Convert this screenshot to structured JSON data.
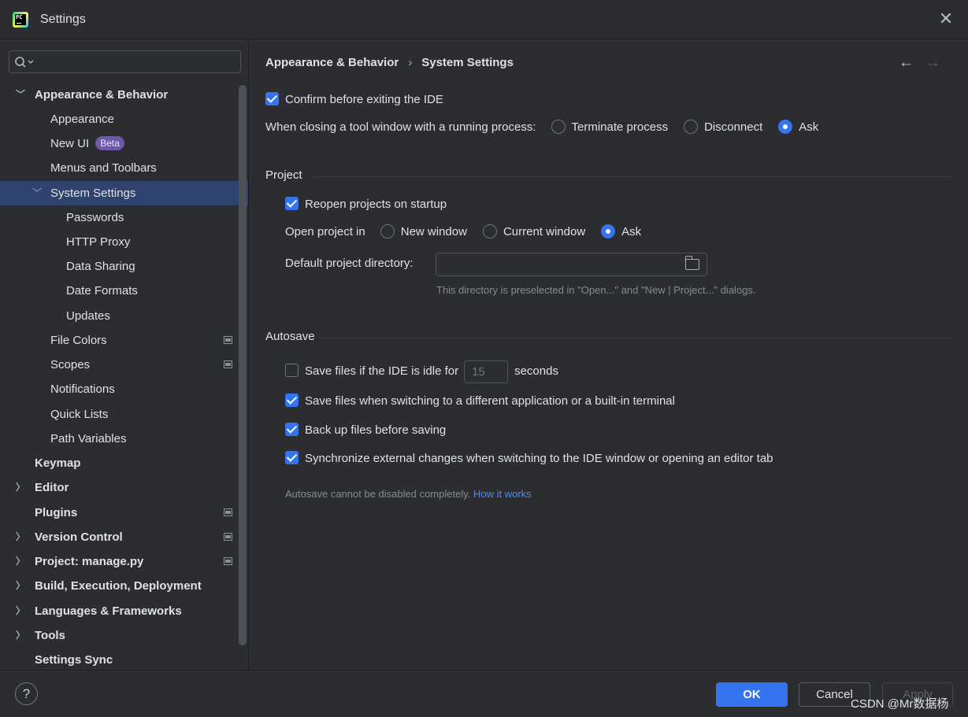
{
  "window": {
    "title": "Settings"
  },
  "sidebar": {
    "search_placeholder": "",
    "items": [
      {
        "label": "Appearance & Behavior",
        "expanded": true
      },
      {
        "label": "Appearance"
      },
      {
        "label": "New UI",
        "badge": "Beta"
      },
      {
        "label": "Menus and Toolbars"
      },
      {
        "label": "System Settings",
        "expanded": true,
        "selected": true
      },
      {
        "label": "Passwords"
      },
      {
        "label": "HTTP Proxy"
      },
      {
        "label": "Data Sharing"
      },
      {
        "label": "Date Formats"
      },
      {
        "label": "Updates"
      },
      {
        "label": "File Colors",
        "project_level": true
      },
      {
        "label": "Scopes",
        "project_level": true
      },
      {
        "label": "Notifications"
      },
      {
        "label": "Quick Lists"
      },
      {
        "label": "Path Variables"
      },
      {
        "label": "Keymap"
      },
      {
        "label": "Editor"
      },
      {
        "label": "Plugins",
        "project_level": true
      },
      {
        "label": "Version Control",
        "project_level": true
      },
      {
        "label": "Project: manage.py",
        "project_level": true
      },
      {
        "label": "Build, Execution, Deployment"
      },
      {
        "label": "Languages & Frameworks"
      },
      {
        "label": "Tools"
      },
      {
        "label": "Settings Sync"
      }
    ]
  },
  "breadcrumb": {
    "parent": "Appearance & Behavior",
    "current": "System Settings"
  },
  "general": {
    "confirm_exit": {
      "label": "Confirm before exiting the IDE",
      "checked": true
    },
    "closing_tool_window": {
      "label": "When closing a tool window with a running process:",
      "options": [
        "Terminate process",
        "Disconnect",
        "Ask"
      ],
      "selected": "Ask"
    }
  },
  "project": {
    "title": "Project",
    "reopen": {
      "label": "Reopen projects on startup",
      "checked": true
    },
    "open_in": {
      "label": "Open project in",
      "options": [
        "New window",
        "Current window",
        "Ask"
      ],
      "selected": "Ask"
    },
    "default_dir": {
      "label": "Default project directory:",
      "value": "",
      "hint": "This directory is preselected in \"Open...\" and \"New | Project...\" dialogs."
    }
  },
  "autosave": {
    "title": "Autosave",
    "idle": {
      "label": "Save files if the IDE is idle for",
      "value": "15",
      "unit": "seconds",
      "checked": false
    },
    "switch_app": {
      "label": "Save files when switching to a different application or a built-in terminal",
      "checked": true
    },
    "backup": {
      "label": "Back up files before saving",
      "checked": true
    },
    "sync": {
      "label": "Synchronize external changes when switching to the IDE window or opening an editor tab",
      "checked": true
    },
    "note": "Autosave cannot be disabled completely.",
    "note_link": "How it works"
  },
  "footer": {
    "help": "?",
    "ok": "OK",
    "cancel": "Cancel",
    "apply": "Apply",
    "watermark": "CSDN @Mr数据杨"
  },
  "colors": {
    "accent": "#3574f0",
    "selection": "#2e436e",
    "background": "#2b2d30",
    "link": "#548af7"
  }
}
